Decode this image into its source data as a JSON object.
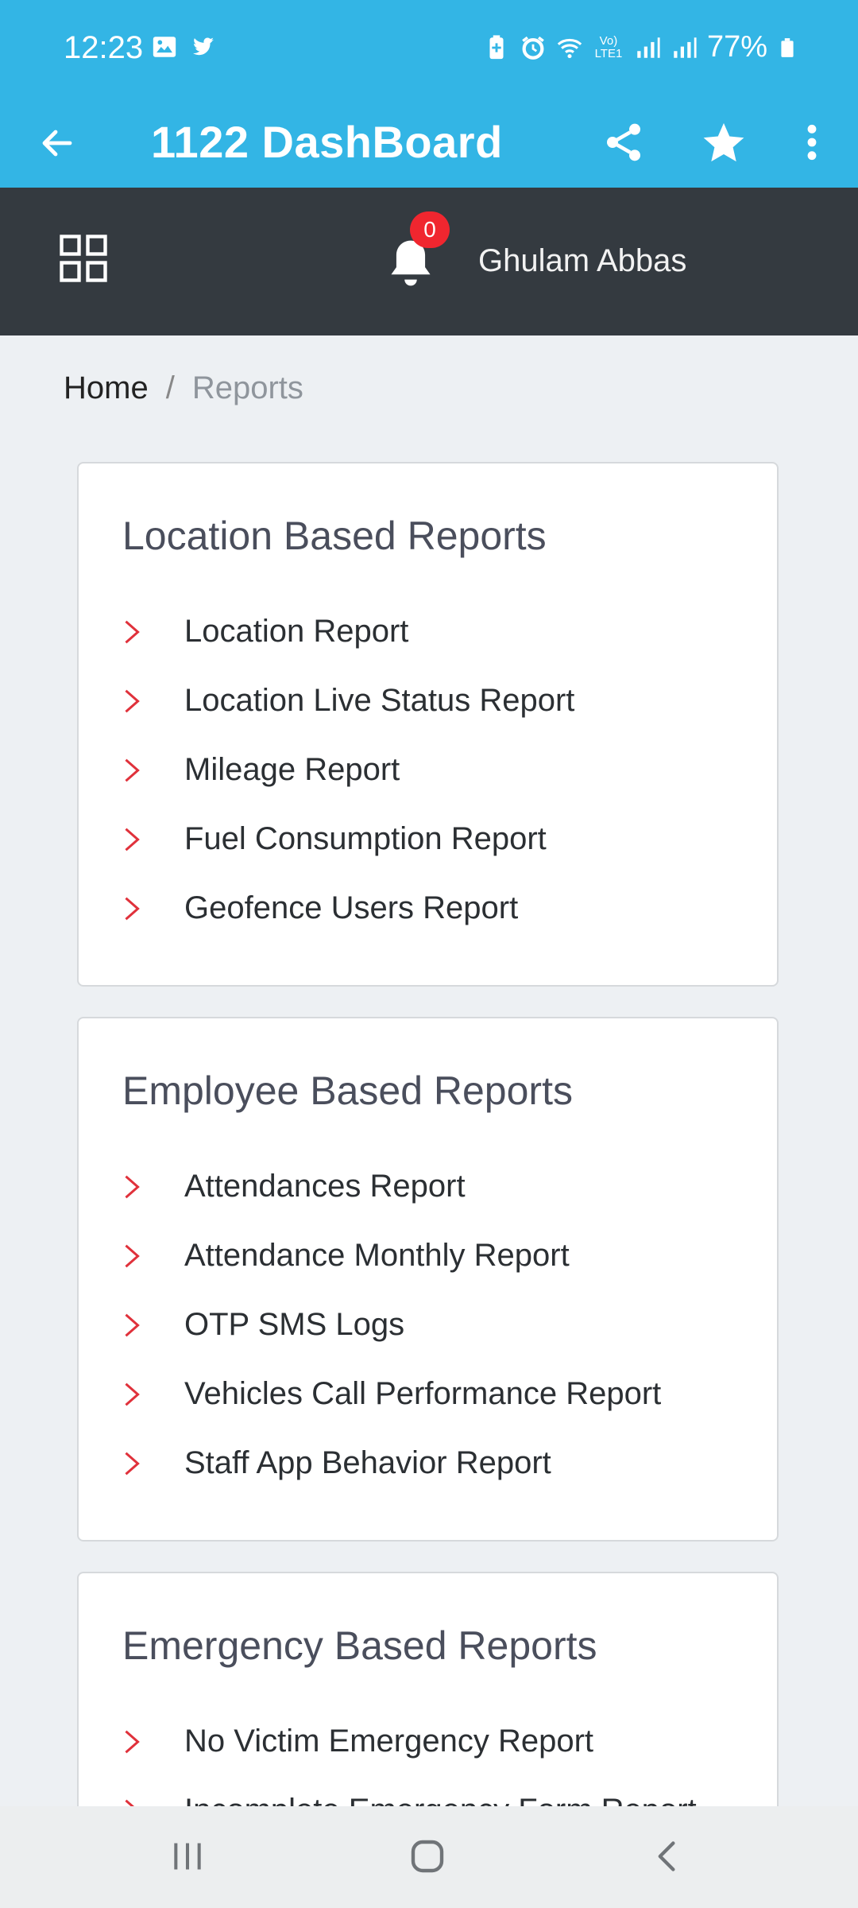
{
  "status_bar": {
    "time": "12:23",
    "battery": "77%",
    "left_icons": [
      "image-icon",
      "twitter-icon"
    ],
    "right_icons": [
      "battery-saver-icon",
      "alarm-icon",
      "wifi-icon",
      "volte-icon",
      "signal-icon",
      "signal-icon",
      "battery-icon"
    ],
    "network_label": "Vo) LTE1"
  },
  "app_bar": {
    "title": "1122 DashBoard",
    "actions": [
      "share-icon",
      "star-icon",
      "more-vert-icon"
    ]
  },
  "header": {
    "notification_count": "0",
    "user_name": "Ghulam Abbas"
  },
  "breadcrumb": {
    "home": "Home",
    "separator": "/",
    "current": "Reports"
  },
  "sections": [
    {
      "title": "Location Based Reports",
      "items": [
        "Location Report",
        "Location Live Status Report",
        "Mileage Report",
        "Fuel Consumption Report",
        "Geofence Users Report"
      ]
    },
    {
      "title": "Employee Based Reports",
      "items": [
        "Attendances Report",
        "Attendance Monthly Report",
        "OTP SMS Logs",
        "Vehicles Call Performance Report",
        "Staff App Behavior Report"
      ]
    },
    {
      "title": "Emergency Based Reports",
      "items": [
        "No Victim Emergency Report",
        "Incomplete Emergency Form Report"
      ]
    }
  ],
  "colors": {
    "primary": "#33b5e5",
    "header_dark": "#343a40",
    "chevron": "#e0313b",
    "badge": "#f0262f",
    "background": "#edf0f3"
  },
  "nav": [
    "recent-apps-icon",
    "home-icon",
    "back-icon"
  ]
}
